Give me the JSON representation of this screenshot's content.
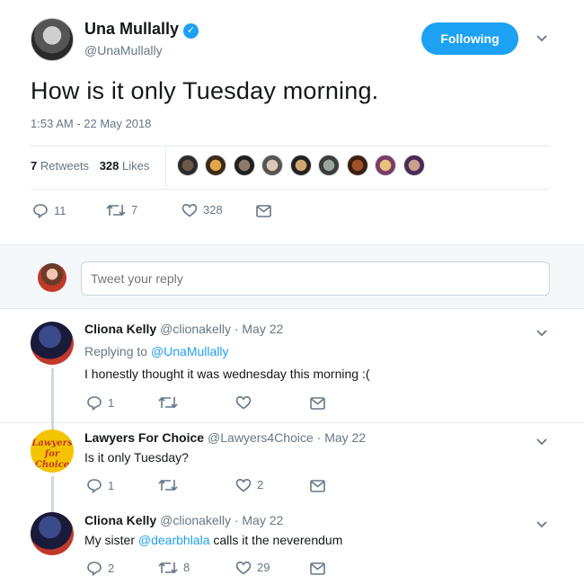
{
  "tweet": {
    "name": "Una Mullally",
    "handle": "@UnaMullally",
    "follow_label": "Following",
    "text": "How is it only Tuesday morning.",
    "timestamp": "1:53 AM - 22 May 2018",
    "retweets_count": "7",
    "retweets_label": "Retweets",
    "likes_count": "328",
    "likes_label": "Likes",
    "actions": {
      "replies": "11",
      "retweets": "7",
      "likes": "328"
    }
  },
  "reply_box": {
    "placeholder": "Tweet your reply"
  },
  "replies": [
    {
      "name": "Cliona Kelly",
      "meta": "@clionakelly · May 22",
      "replying_prefix": "Replying to",
      "replying_handle": "@UnaMullally",
      "text": "I honestly thought it was wednesday this morning :(",
      "actions": {
        "replies": "1",
        "retweets": "",
        "likes": ""
      }
    },
    {
      "name": "Lawyers For Choice",
      "meta": "@Lawyers4Choice · May 22",
      "text": "Is it only Tuesday?",
      "avatar_text": "Lawyers for Choice",
      "actions": {
        "replies": "1",
        "retweets": "",
        "likes": "2"
      }
    },
    {
      "name": "Cliona Kelly",
      "meta": "@clionakelly · May 22",
      "text_prefix": "My sister ",
      "text_mention": "@dearbhlala",
      "text_suffix": " calls it the neverendum",
      "actions": {
        "replies": "2",
        "retweets": "8",
        "likes": "29"
      }
    }
  ],
  "icons": {
    "verified": "verified-badge-icon",
    "chevron": "chevron-down-icon",
    "reply": "reply-icon",
    "retweet": "retweet-icon",
    "like": "heart-icon",
    "dm": "envelope-icon"
  },
  "colors": {
    "accent": "#1da1f2",
    "text": "#14171a",
    "muted": "#657786",
    "border": "#e6ecf0",
    "reply_bg": "#f5f8fa"
  }
}
